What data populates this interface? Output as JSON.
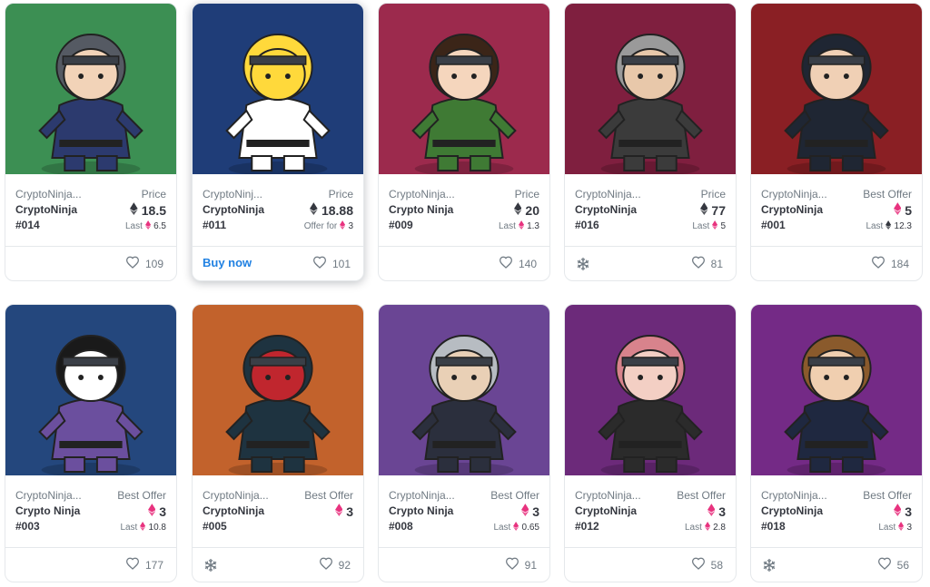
{
  "cards": [
    {
      "collection": "CryptoNinja...",
      "name": "CryptoNinja",
      "number": "#014",
      "price_label": "Price",
      "price": "18.5",
      "price_currency": "eth",
      "sub_label": "Last",
      "sub_value": "6.5",
      "sub_currency": "weth",
      "likes": "109",
      "footer_icon": "",
      "buy_now": "",
      "bg": "#3c8f53"
    },
    {
      "collection": "CryptoNinj...",
      "name": "CryptoNinja",
      "number": "#011",
      "price_label": "Price",
      "price": "18.88",
      "price_currency": "eth",
      "sub_label": "Offer for",
      "sub_value": "3",
      "sub_currency": "weth",
      "likes": "101",
      "footer_icon": "",
      "buy_now": "Buy now",
      "bg": "#1f3d78"
    },
    {
      "collection": "CryptoNinja...",
      "name": "Crypto Ninja",
      "number": "#009",
      "price_label": "Price",
      "price": "20",
      "price_currency": "eth",
      "sub_label": "Last",
      "sub_value": "1.3",
      "sub_currency": "weth",
      "likes": "140",
      "footer_icon": "",
      "buy_now": "",
      "bg": "#9c2a4d"
    },
    {
      "collection": "CryptoNinja...",
      "name": "CryptoNinja",
      "number": "#016",
      "price_label": "Price",
      "price": "77",
      "price_currency": "eth",
      "sub_label": "Last",
      "sub_value": "5",
      "sub_currency": "weth",
      "likes": "81",
      "footer_icon": "snowflake-icon",
      "buy_now": "",
      "bg": "#7f1f3f"
    },
    {
      "collection": "CryptoNinja...",
      "name": "CryptoNinja",
      "number": "#001",
      "price_label": "Best Offer",
      "price": "5",
      "price_currency": "weth",
      "sub_label": "Last",
      "sub_value": "12.3",
      "sub_currency": "eth",
      "likes": "184",
      "footer_icon": "",
      "buy_now": "",
      "bg": "#8a1f24"
    },
    {
      "collection": "CryptoNinja...",
      "name": "Crypto Ninja",
      "number": "#003",
      "price_label": "Best Offer",
      "price": "3",
      "price_currency": "weth",
      "sub_label": "Last",
      "sub_value": "10.8",
      "sub_currency": "weth",
      "likes": "177",
      "footer_icon": "",
      "buy_now": "",
      "bg": "#24477d"
    },
    {
      "collection": "CryptoNinja...",
      "name": "CryptoNinja",
      "number": "#005",
      "price_label": "Best Offer",
      "price": "3",
      "price_currency": "weth",
      "sub_label": "",
      "sub_value": "",
      "sub_currency": "",
      "likes": "92",
      "footer_icon": "snowflake-icon",
      "buy_now": "",
      "bg": "#c2622c"
    },
    {
      "collection": "CryptoNinja...",
      "name": "Crypto Ninja",
      "number": "#008",
      "price_label": "Best Offer",
      "price": "3",
      "price_currency": "weth",
      "sub_label": "Last",
      "sub_value": "0.65",
      "sub_currency": "weth",
      "likes": "91",
      "footer_icon": "",
      "buy_now": "",
      "bg": "#6a4594"
    },
    {
      "collection": "CryptoNinja...",
      "name": "CryptoNinja",
      "number": "#012",
      "price_label": "Best Offer",
      "price": "3",
      "price_currency": "weth",
      "sub_label": "Last",
      "sub_value": "2.8",
      "sub_currency": "weth",
      "likes": "58",
      "footer_icon": "",
      "buy_now": "",
      "bg": "#6c2a7a"
    },
    {
      "collection": "CryptoNinja...",
      "name": "CryptoNinja",
      "number": "#018",
      "price_label": "Best Offer",
      "price": "3",
      "price_currency": "weth",
      "sub_label": "Last",
      "sub_value": "3",
      "sub_currency": "weth",
      "likes": "56",
      "footer_icon": "snowflake-icon",
      "buy_now": "",
      "bg": "#742a86"
    }
  ],
  "colors": {
    "weth": "#e8337f",
    "eth": "#353840",
    "link": "#2081e2",
    "muted": "#707a83"
  }
}
